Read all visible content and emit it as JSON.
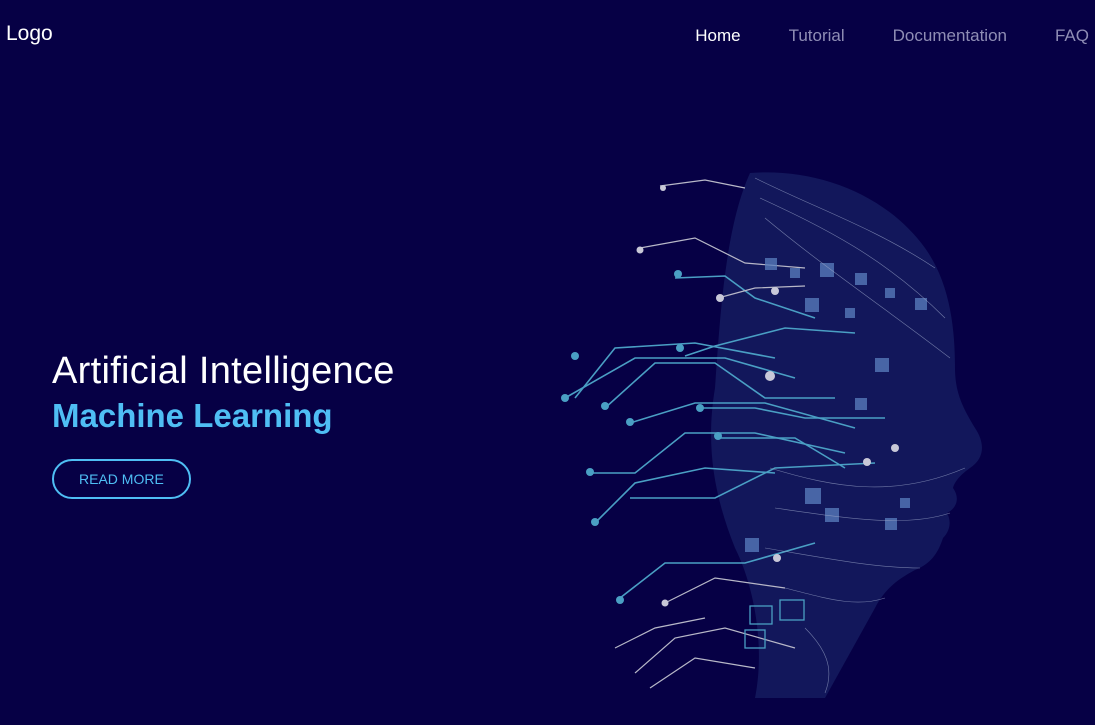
{
  "header": {
    "logo": "Logo",
    "nav": [
      {
        "label": "Home",
        "active": true
      },
      {
        "label": "Tutorial",
        "active": false
      },
      {
        "label": "Documentation",
        "active": false
      },
      {
        "label": "FAQ",
        "active": false
      }
    ]
  },
  "hero": {
    "title": "Artificial Intelligence",
    "subtitle": "Machine Learning",
    "button": "READ MORE",
    "image": "ai-head-circuit-illustration"
  },
  "colors": {
    "background": "#060045",
    "accent": "#4fbef4",
    "nav_inactive": "#8f8db5",
    "circuit": "#4a9fc4"
  }
}
